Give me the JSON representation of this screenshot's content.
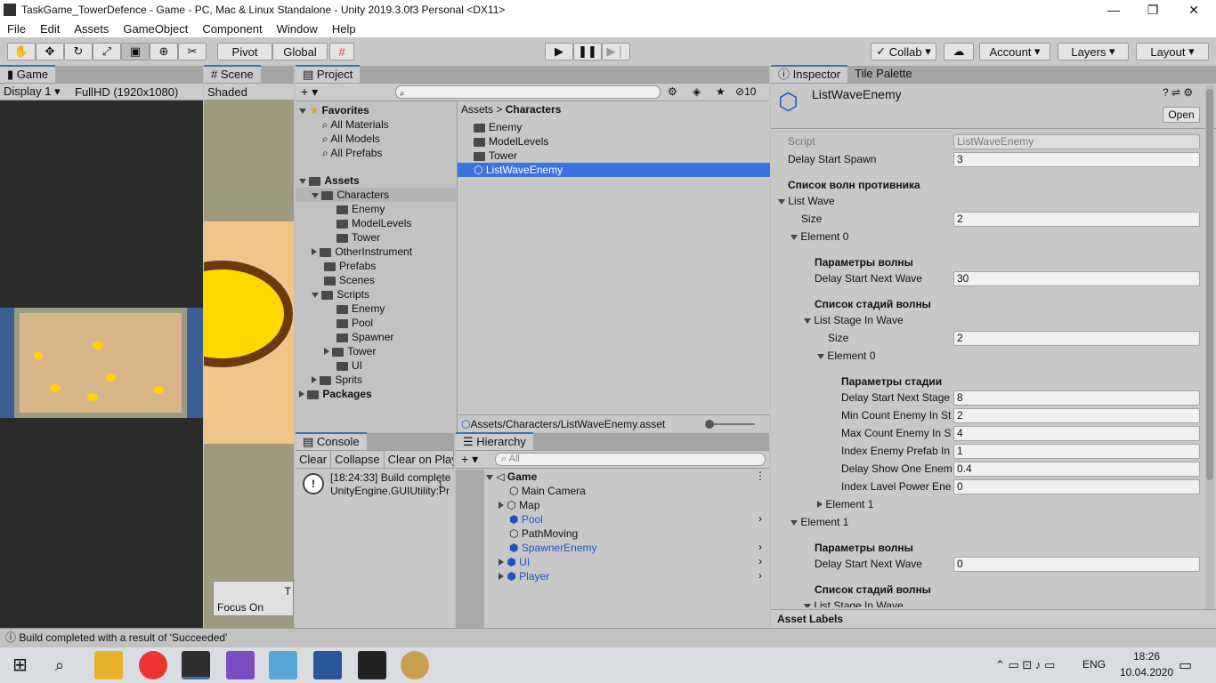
{
  "window": {
    "title": "TaskGame_TowerDefence - Game - PC, Mac & Linux Standalone - Unity 2019.3.0f3 Personal <DX11>",
    "min": "—",
    "max": "❐",
    "close": "✕"
  },
  "menu": [
    "File",
    "Edit",
    "Assets",
    "GameObject",
    "Component",
    "Window",
    "Help"
  ],
  "toolbar": {
    "pivot": "Pivot",
    "global": "Global",
    "collab": "Collab",
    "account": "Account",
    "layers": "Layers",
    "layout": "Layout"
  },
  "game": {
    "tab": "Game",
    "display": "Display 1",
    "resolution": "FullHD (1920x1080)"
  },
  "scene": {
    "tab": "Scene",
    "shading": "Shaded",
    "focus": "Focus On",
    "t_frag": "T"
  },
  "project": {
    "tab": "Project",
    "hidden_count": "10",
    "favorites": "Favorites",
    "fav_items": [
      "All Materials",
      "All Models",
      "All Prefabs"
    ],
    "assets": "Assets",
    "tree": [
      {
        "label": "Characters"
      },
      {
        "label": "Enemy"
      },
      {
        "label": "ModelLevels"
      },
      {
        "label": "Tower"
      },
      {
        "label": "OtherInstrument"
      },
      {
        "label": "Prefabs"
      },
      {
        "label": "Scenes"
      },
      {
        "label": "Scripts"
      },
      {
        "label": "Enemy"
      },
      {
        "label": "Pool"
      },
      {
        "label": "Spawner"
      },
      {
        "label": "Tower"
      },
      {
        "label": "UI"
      },
      {
        "label": "Sprits"
      }
    ],
    "packages": "Packages",
    "breadcrumb_root": "Assets",
    "breadcrumb_current": "Characters",
    "files": [
      "Enemy",
      "ModelLevels",
      "Tower",
      "ListWaveEnemy"
    ],
    "path": "Assets/Characters/ListWaveEnemy.asset"
  },
  "console": {
    "tab": "Console",
    "clear": "Clear",
    "collapse": "Collapse",
    "clear_on_play": "Clear on Play",
    "msg1": "[18:24:33] Build complete",
    "msg2": "UnityEngine.GUIUtility:Pr",
    "count": "1"
  },
  "hierarchy": {
    "tab": "Hierarchy",
    "search_placeholder": "All",
    "scene": "Game",
    "items": [
      "Main Camera",
      "Map",
      "Pool",
      "PathMoving",
      "SpawnerEnemy",
      "UI",
      "Player"
    ]
  },
  "inspector": {
    "tab": "Inspector",
    "tab2": "Tile Palette",
    "asset_name": "ListWaveEnemy",
    "open": "Open",
    "script_label": "Script",
    "script_value": "ListWaveEnemy",
    "delay_start_spawn_label": "Delay Start Spawn",
    "delay_start_spawn": "3",
    "header_waves": "Список волн противника",
    "list_wave": "List Wave",
    "size_label": "Size",
    "size": "2",
    "element0": "Element 0",
    "wave_params": "Параметры волны",
    "delay_next_wave_label": "Delay Start Next Wave",
    "delay_next_wave_0": "30",
    "stage_list_header": "Список стадий волны",
    "list_stage": "List Stage In Wave",
    "stage_size": "2",
    "stage_el0": "Element 0",
    "stage_params": "Параметры стадии",
    "stage_fields": [
      {
        "label": "Delay Start Next Stage",
        "value": "8"
      },
      {
        "label": "Min Count Enemy In Stage",
        "value": "2"
      },
      {
        "label": "Max Count Enemy In Stage",
        "value": "4"
      },
      {
        "label": "Index Enemy Prefab In",
        "value": "1"
      },
      {
        "label": "Delay Show One Enemy",
        "value": "0.4"
      },
      {
        "label": "Index Lavel Power Enemy",
        "value": "0"
      }
    ],
    "stage_el1": "Element 1",
    "element1": "Element 1",
    "delay_next_wave_1": "0",
    "asset_labels": "Asset Labels"
  },
  "status": "Build completed with a result of 'Succeeded'",
  "taskbar": {
    "lang": "ENG",
    "time": "18:26",
    "date": "10.04.2020"
  },
  "colors": {
    "selection": "#3a72e0",
    "link": "#1d52c8",
    "accent_tab": "#3a72b0"
  }
}
